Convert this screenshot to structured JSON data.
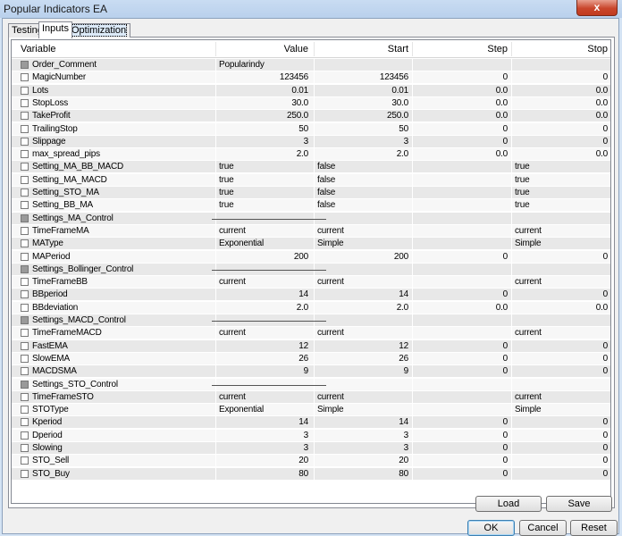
{
  "window": {
    "title": "Popular Indicators EA",
    "close_glyph": "x"
  },
  "tabs": [
    "Testing",
    "Inputs",
    "Optimization"
  ],
  "columns": {
    "variable": "Variable",
    "value": "Value",
    "start": "Start",
    "step": "Step",
    "stop": "Stop"
  },
  "rows": [
    {
      "name": "Order_Comment",
      "kind": "header",
      "value": "Popularindy",
      "start": "",
      "step": "",
      "stop": ""
    },
    {
      "name": "MagicNumber",
      "value": "123456",
      "start": "123456",
      "step": "0",
      "stop": "0"
    },
    {
      "name": "Lots",
      "value": "0.01",
      "start": "0.01",
      "step": "0.0",
      "stop": "0.0"
    },
    {
      "name": "StopLoss",
      "value": "30.0",
      "start": "30.0",
      "step": "0.0",
      "stop": "0.0"
    },
    {
      "name": "TakeProfit",
      "value": "250.0",
      "start": "250.0",
      "step": "0.0",
      "stop": "0.0"
    },
    {
      "name": "TrailingStop",
      "value": "50",
      "start": "50",
      "step": "0",
      "stop": "0"
    },
    {
      "name": "Slippage",
      "value": "3",
      "start": "3",
      "step": "0",
      "stop": "0"
    },
    {
      "name": "max_spread_pips",
      "value": "2.0",
      "start": "2.0",
      "step": "0.0",
      "stop": "0.0"
    },
    {
      "name": "Setting_MA_BB_MACD",
      "kind": "text",
      "value": "true",
      "start": "false",
      "step": "",
      "stop": "true"
    },
    {
      "name": "Setting_MA_MACD",
      "kind": "text",
      "value": "true",
      "start": "false",
      "step": "",
      "stop": "true"
    },
    {
      "name": "Setting_STO_MA",
      "kind": "text",
      "value": "true",
      "start": "false",
      "step": "",
      "stop": "true"
    },
    {
      "name": "Setting_BB_MA",
      "kind": "text",
      "value": "true",
      "start": "false",
      "step": "",
      "stop": "true"
    },
    {
      "name": "Settings_MA_Control",
      "kind": "line",
      "value": "",
      "start": "",
      "step": "",
      "stop": ""
    },
    {
      "name": "TimeFrameMA",
      "kind": "text",
      "value": "current",
      "start": "current",
      "step": "",
      "stop": "current"
    },
    {
      "name": "MAType",
      "kind": "text",
      "value": "Exponential",
      "start": "Simple",
      "step": "",
      "stop": "Simple"
    },
    {
      "name": "MAPeriod",
      "value": "200",
      "start": "200",
      "step": "0",
      "stop": "0"
    },
    {
      "name": "Settings_Bollinger_Control",
      "kind": "line",
      "value": "",
      "start": "",
      "step": "",
      "stop": ""
    },
    {
      "name": "TimeFrameBB",
      "kind": "text",
      "value": "current",
      "start": "current",
      "step": "",
      "stop": "current"
    },
    {
      "name": "BBperiod",
      "value": "14",
      "start": "14",
      "step": "0",
      "stop": "0"
    },
    {
      "name": "BBdeviation",
      "value": "2.0",
      "start": "2.0",
      "step": "0.0",
      "stop": "0.0"
    },
    {
      "name": "Settings_MACD_Control",
      "kind": "line",
      "value": "",
      "start": "",
      "step": "",
      "stop": ""
    },
    {
      "name": "TimeFrameMACD",
      "kind": "text",
      "value": "current",
      "start": "current",
      "step": "",
      "stop": "current"
    },
    {
      "name": "FastEMA",
      "value": "12",
      "start": "12",
      "step": "0",
      "stop": "0"
    },
    {
      "name": "SlowEMA",
      "value": "26",
      "start": "26",
      "step": "0",
      "stop": "0"
    },
    {
      "name": "MACDSMA",
      "value": "9",
      "start": "9",
      "step": "0",
      "stop": "0"
    },
    {
      "name": "Settings_STO_Control",
      "kind": "line",
      "value": "",
      "start": "",
      "step": "",
      "stop": ""
    },
    {
      "name": "TimeFrameSTO",
      "kind": "text",
      "value": "current",
      "start": "current",
      "step": "",
      "stop": "current"
    },
    {
      "name": "STOType",
      "kind": "text",
      "value": "Exponential",
      "start": "Simple",
      "step": "",
      "stop": "Simple"
    },
    {
      "name": "Kperiod",
      "value": "14",
      "start": "14",
      "step": "0",
      "stop": "0"
    },
    {
      "name": "Dperiod",
      "value": "3",
      "start": "3",
      "step": "0",
      "stop": "0"
    },
    {
      "name": "Slowing",
      "value": "3",
      "start": "3",
      "step": "0",
      "stop": "0"
    },
    {
      "name": "STO_Sell",
      "value": "20",
      "start": "20",
      "step": "0",
      "stop": "0"
    },
    {
      "name": "STO_Buy",
      "value": "80",
      "start": "80",
      "step": "0",
      "stop": "0"
    }
  ],
  "buttons": {
    "load": "Load",
    "save": "Save",
    "ok": "OK",
    "cancel": "Cancel",
    "reset": "Reset"
  }
}
